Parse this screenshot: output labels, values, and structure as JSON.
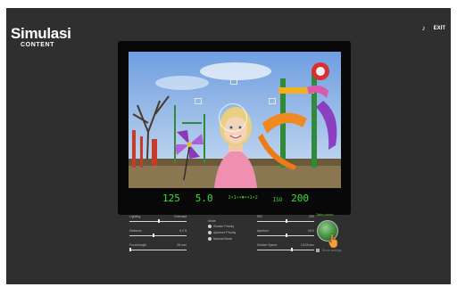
{
  "brand": {
    "title": "Simulasi",
    "subtitle": "CONTENT"
  },
  "top_bar": {
    "sound_icon": "music-note-icon",
    "exit_label": "EXIT"
  },
  "viewfinder": {
    "shutter": "125",
    "aperture": "5.0",
    "meter": "2•1••▼••1•2",
    "iso_label": "ISO",
    "iso": "200"
  },
  "controls": {
    "left": [
      {
        "label": "Lighting",
        "value": "Overcast",
        "level": 0.5
      },
      {
        "label": "Distance",
        "value": "6.2 ft",
        "level": 0.4
      },
      {
        "label": "Focal length",
        "value": "28 mm",
        "level": 0.0
      }
    ],
    "mode": {
      "title": "Mode",
      "options": [
        "Shutter Priority",
        "Aperture Priority",
        "Manual Mode"
      ]
    },
    "right": [
      {
        "label": "ISO",
        "value": "200",
        "level": 0.5
      },
      {
        "label": "Aperture",
        "value": "f/5.0",
        "level": 0.5
      },
      {
        "label": "Shutter Speed",
        "value": "1/125 sec",
        "level": 0.6
      }
    ]
  },
  "shutter_button": {
    "label": "Take photo"
  },
  "footer": {
    "label": "Show settings"
  },
  "colors": {
    "lcd_green": "#38e038",
    "panel": "#2f2f2f",
    "accent_green": "#6ec04a"
  }
}
